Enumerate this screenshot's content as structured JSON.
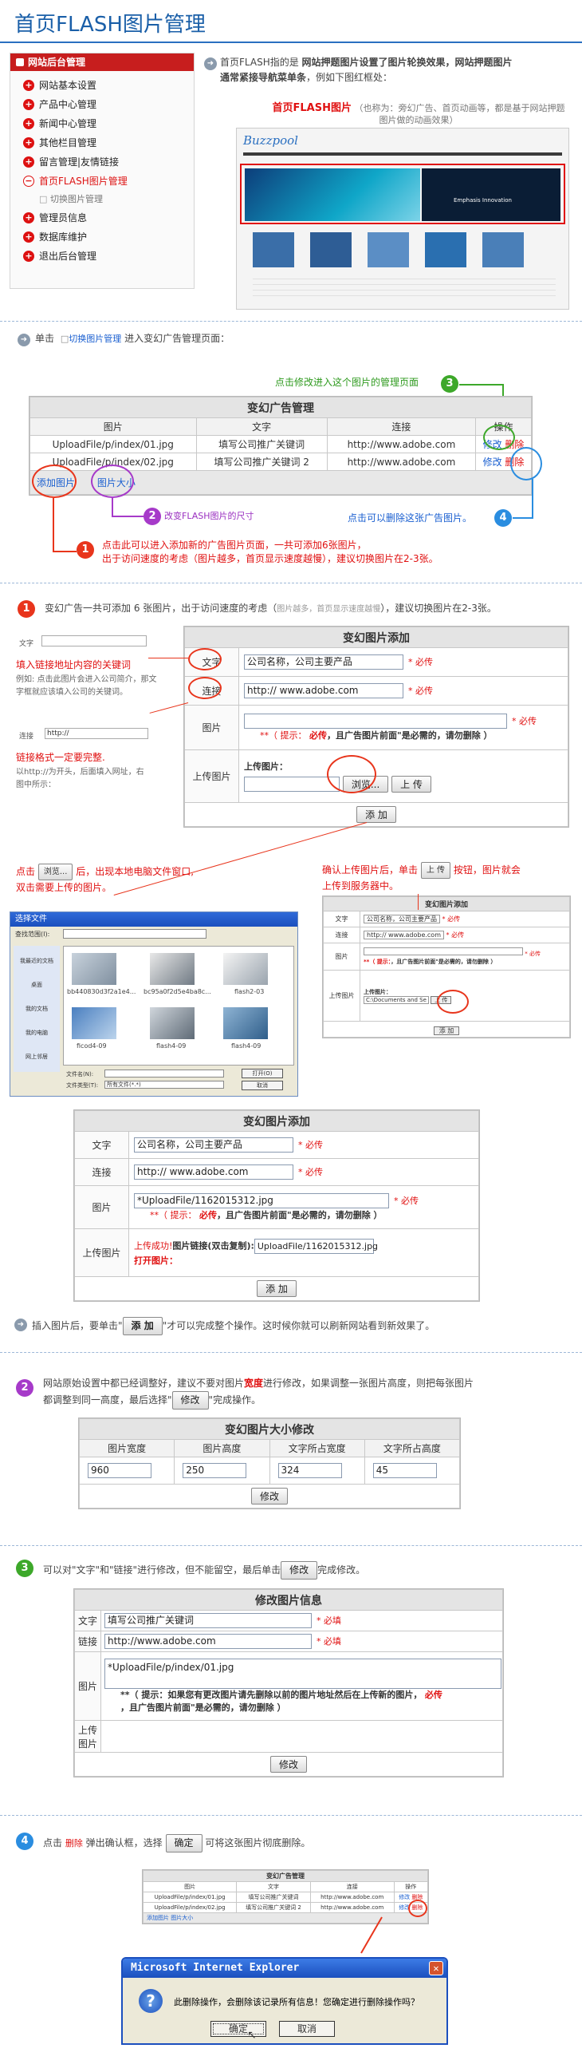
{
  "page_title": "首页FLASH图片管理",
  "sidebar": {
    "header": "网站后台管理",
    "items": [
      {
        "label": "网站基本设置"
      },
      {
        "label": "产品中心管理"
      },
      {
        "label": "新闻中心管理"
      },
      {
        "label": "其他栏目管理"
      },
      {
        "label": "留言管理|友情链接"
      },
      {
        "label": "首页FLASH图片管理",
        "active": true,
        "sub": "切换图片管理"
      },
      {
        "label": "管理员信息"
      },
      {
        "label": "数据库维护"
      },
      {
        "label": "退出后台管理"
      }
    ]
  },
  "intro": {
    "line1_prefix": "首页FLASH指的是",
    "line1_bold": "网站押题图片设置了图片轮换效果，网站押题图片",
    "line2_bold": "通常紧接导航菜单条",
    "line2_suffix": "，例如下图红框处：",
    "callout_red": "首页FLASH图片",
    "callout_gray": "（也称为：旁幻广告、首页动画等，都是基于网站押题图片做的动画效果）",
    "preview_logo": "Buzzpool",
    "preview_caption": "Emphasis Innovation"
  },
  "step_click": {
    "prefix": "单击",
    "link": "切换图片管理",
    "suffix": "进入变幻广告管理页面："
  },
  "ad_table": {
    "caption": "变幻广告管理",
    "headers": [
      "图片",
      "文字",
      "连接",
      "操作"
    ],
    "rows": [
      {
        "img": "UploadFile/p/index/01.jpg",
        "text": "填写公司推广关键词",
        "link": "http://www.adobe.com",
        "edit": "修改",
        "del": "删除"
      },
      {
        "img": "UploadFile/p/index/02.jpg",
        "text": "填写公司推广关键词 2",
        "link": "http://www.adobe.com",
        "edit": "修改",
        "del": "删除"
      }
    ],
    "add_link": "添加图片",
    "size_link": "图片大小"
  },
  "annotations": {
    "n3": "点击修改进入这个图片的管理页面",
    "n2": "改变FLASH图片的尺寸",
    "n4": "点击可以删除这张广告图片。",
    "n1_line1": "点击此可以进入添加新的广告图片页面，一共可添加6张图片，",
    "n1_line2": "出于访问速度的考虑（图片越多，首页显示速度越慢），建议切换图片在2-3张。"
  },
  "section1": {
    "num": "1",
    "text_a": "变幻广告一共可添加 6 张图片，出于访问速度的考虑（",
    "text_b": "图片越多，首页显示速度越慢",
    "text_c": "），建议切换图片在2-3张。",
    "left_label_text": "文字",
    "left_note_red": "填入链接地址内容的关键词",
    "left_note_gray": "例如: 点击此图片会进入公司简介，那文字框就应该填入公司的关键词。",
    "left_link_label": "连接",
    "left_link_value": "http://",
    "left_link_red": "链接格式一定要完整.",
    "left_link_gray": "以http://为开头，后面填入网址，右图中所示："
  },
  "add_form": {
    "caption": "变幻图片添加",
    "label_text": "文字",
    "label_link": "连接",
    "label_image": "图片",
    "label_upload": "上传图片",
    "text_value": "公司名称，公司主要产品",
    "link_value": "http:// www.adobe.com",
    "required": "* 必传",
    "hint_prefix": "**（ 提示：",
    "hint_red": "必传",
    "hint_suffix": "，且广告图片前面\"是必需的，请勿删除 ）",
    "upload_title": "上传图片：",
    "browse_btn": "浏览...",
    "upload_btn": "上 传",
    "add_btn": "添 加"
  },
  "browse_note": {
    "prefix": "点击",
    "btn": "浏览...",
    "suffix": "后，出现本地电脑文件窗口,",
    "line2": "双击需要上传的图片。"
  },
  "upload_note": {
    "prefix": "确认上传图片后，单击",
    "btn": "上 传",
    "suffix": "按钮，图片就会",
    "line2": "上传到服务器中。"
  },
  "file_dialog": {
    "title": "选择文件",
    "lookin_label": "查找范围(I):",
    "places": [
      "我最近的文档",
      "桌面",
      "我的文档",
      "我的电脑",
      "网上邻居"
    ],
    "thumbs": [
      "bb440830d3f2a1e4...",
      "bc95a0f2d5e4ba8c...",
      "flash2-03",
      "ficod4-09",
      "flash4-09",
      "flash4-09"
    ],
    "filename_label": "文件名(N):",
    "filetype_label": "文件类型(T):",
    "filetype_value": "所有文件(*.*)",
    "open_btn": "打开(O)",
    "cancel_btn": "取消"
  },
  "mini_form": {
    "caption": "变幻图片添加",
    "path_value": "C:\\Documents and Se",
    "add_btn": "添 加"
  },
  "after_upload_form": {
    "caption": "变幻图片添加",
    "text_value": "公司名称，公司主要产品",
    "link_value": "http:// www.adobe.com",
    "image_value": "*UploadFile/1162015312.jpg",
    "success_prefix": "上传成功!",
    "success_bold": "图片链接(双击复制):",
    "success_value": "UploadFile/1162015312.jpg",
    "open_image": "打开图片：",
    "add_btn": "添 加"
  },
  "insert_note": {
    "prefix": "插入图片后，要单击\"",
    "btn": "添 加",
    "suffix": "\"才可以完成整个操作。这时候你就可以刷新网站看到新效果了。"
  },
  "section2": {
    "num": "2",
    "line1_a": "网站原始设置中都已经调整好，建议不要对图片",
    "line1_red": "宽度",
    "line1_b": "进行修改，如果调整一张图片高度，则把每张图片",
    "line2_a": "都调整到同一高度，最后选择\"",
    "btn": "修改",
    "line2_b": "\"完成操作。"
  },
  "size_form": {
    "caption": "变幻图片大小修改",
    "headers": [
      "图片宽度",
      "图片高度",
      "文字所占宽度",
      "文字所占高度"
    ],
    "values": [
      "960",
      "250",
      "324",
      "45"
    ],
    "btn": "修改"
  },
  "section3": {
    "num": "3",
    "text_a": "可以对\"文字\"和\"链接\"进行修改，但不能留空，最后单击",
    "btn": "修改",
    "text_b": "完成修改。"
  },
  "edit_form": {
    "caption": "修改图片信息",
    "label_text": "文字",
    "label_link": "链接",
    "label_image": "图片",
    "label_upload": "上传图片",
    "text_value": "填写公司推广关键词",
    "link_value": "http://www.adobe.com",
    "image_value": "*UploadFile/p/index/01.jpg",
    "required": "* 必填",
    "hint_a": "**（ 提示：如果您有更改图片请先删除以前的图片地址然后在上传新的图片，",
    "hint_red": "必传",
    "hint_b": "，且广告图片前面\"是必需的，请勿删除 ）",
    "btn": "修改"
  },
  "section4": {
    "num": "4",
    "prefix": "点击",
    "del": "删除",
    "middle": "弹出确认框，选择",
    "btn": "确定",
    "suffix": "可将这张图片彻底删除。"
  },
  "mini_ad_table": {
    "caption": "变幻广告管理",
    "headers": [
      "图片",
      "文字",
      "连接",
      "操作"
    ],
    "rows": [
      [
        "UploadFile/p/index/01.jpg",
        "填写公司推广关键词",
        "http://www.adobe.com"
      ],
      [
        "UploadFile/p/index/02.jpg",
        "填写公司推广关键词 2",
        "http://www.adobe.com"
      ]
    ],
    "footer": "添加图片    图片大小"
  },
  "ie_dialog": {
    "title": "Microsoft Internet Explorer",
    "message": "此删除操作，会删除该记录所有信息！您确定进行删除操作吗？",
    "ok_btn": "确定",
    "cancel_btn": "取消"
  }
}
